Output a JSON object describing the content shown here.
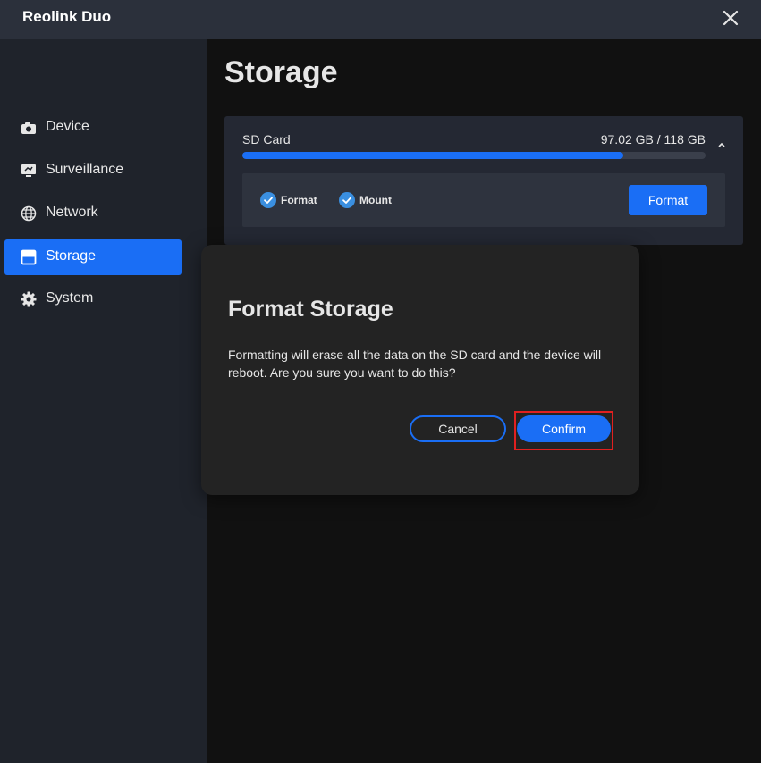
{
  "app": {
    "title": "Reolink Duo",
    "close_icon": "close-icon"
  },
  "sidebar": {
    "items": [
      {
        "label": "Device",
        "icon": "camera-icon",
        "active": false
      },
      {
        "label": "Surveillance",
        "icon": "monitor-icon",
        "active": false
      },
      {
        "label": "Network",
        "icon": "globe-icon",
        "active": false
      },
      {
        "label": "Storage",
        "icon": "storage-icon",
        "active": true
      },
      {
        "label": "System",
        "icon": "gear-icon",
        "active": false
      }
    ]
  },
  "main": {
    "title": "Storage",
    "sd_card": {
      "label": "SD Card",
      "usage": "97.02 GB / 118 GB",
      "used_fraction": 0.822,
      "statuses": [
        {
          "label": "Format",
          "checked": true
        },
        {
          "label": "Mount",
          "checked": true
        }
      ],
      "format_button": "Format"
    }
  },
  "dialog": {
    "title": "Format Storage",
    "message": "Formatting will erase all the data on the SD card and the device will reboot. Are you sure you want to do this?",
    "cancel_label": "Cancel",
    "confirm_label": "Confirm"
  },
  "colors": {
    "accent": "#1a6ef5",
    "highlight": "#e02020",
    "check": "#3a8fe0"
  }
}
